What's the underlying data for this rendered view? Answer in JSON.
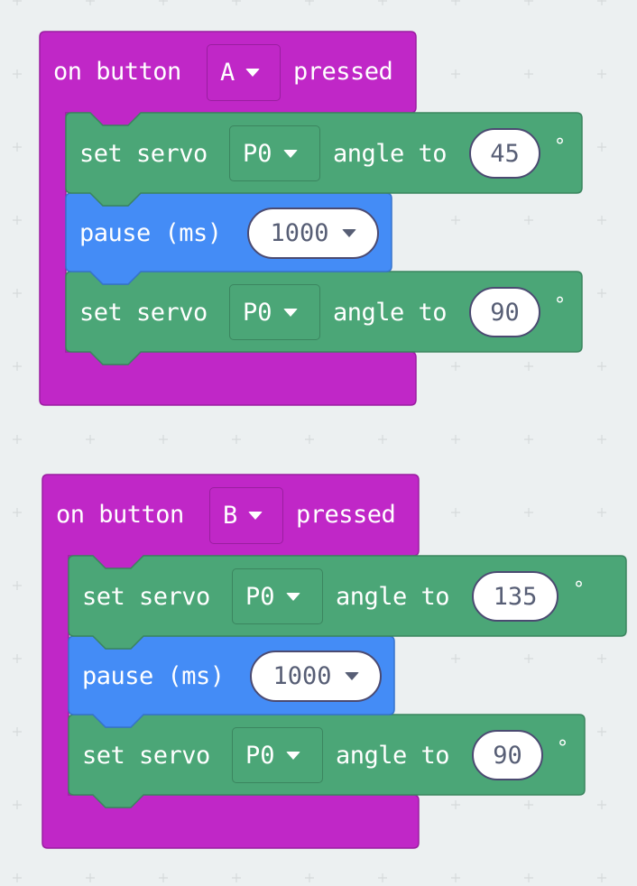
{
  "workspace": {
    "background": "#ecf0f1",
    "grid_color": "#d6dadb"
  },
  "colors": {
    "events": "#c027c7",
    "events_border": "#9a1ea0",
    "servo": "#4ba677",
    "servo_border": "#3b855f",
    "basic": "#448cf6",
    "basic_border": "#3673cc",
    "input_text": "#575e75",
    "input_border": "#4b4a71"
  },
  "handlers": [
    {
      "label_prefix": "on button",
      "button": "A",
      "label_suffix": "pressed",
      "statements": [
        {
          "type": "servo",
          "label": "set servo",
          "pin": "P0",
          "mid": "angle to",
          "value": "45",
          "unit": "°"
        },
        {
          "type": "pause",
          "label": "pause (ms)",
          "value": "1000"
        },
        {
          "type": "servo",
          "label": "set servo",
          "pin": "P0",
          "mid": "angle to",
          "value": "90",
          "unit": "°"
        }
      ]
    },
    {
      "label_prefix": "on button",
      "button": "B",
      "label_suffix": "pressed",
      "statements": [
        {
          "type": "servo",
          "label": "set servo",
          "pin": "P0",
          "mid": "angle to",
          "value": "135",
          "unit": "°"
        },
        {
          "type": "pause",
          "label": "pause (ms)",
          "value": "1000"
        },
        {
          "type": "servo",
          "label": "set servo",
          "pin": "P0",
          "mid": "angle to",
          "value": "90",
          "unit": "°"
        }
      ]
    }
  ]
}
